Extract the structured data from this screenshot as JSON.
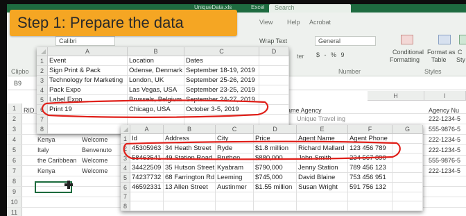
{
  "banner": {
    "text": "Step 1: Prepare the data"
  },
  "window": {
    "title_fragments": [
      "UniqueData.xls",
      "Excel"
    ],
    "search_placeholder": "Search"
  },
  "ribbon": {
    "tabs": [
      "View",
      "Help",
      "Acrobat"
    ],
    "font_name": "Calibri",
    "wrap_text": "Wrap Text",
    "number_format": "General",
    "number_symbols": "$ - % 9",
    "number_group": "Number",
    "alignment_group": "ter",
    "clipboard_group": "Clipbo",
    "conditional_formatting": [
      "Conditional",
      "Formatting"
    ],
    "format_as_table": [
      "Format as",
      "Table"
    ],
    "cell_styles": [
      "C",
      "Sty"
    ],
    "styles_group": "Styles",
    "name_box": "B9"
  },
  "background_sheet": {
    "row_numbers": [
      "1",
      "2",
      "3",
      "4",
      "5",
      "6",
      "7",
      "8",
      "9",
      "10",
      "11"
    ],
    "col_header_right": "H",
    "col_header_far_right": "I",
    "rid_label": "RID",
    "agency_headers": {
      "agency_name": "ame Agency",
      "agency_number": "Agency Nu"
    },
    "agency_rows": [
      {
        "name": "Unique Travel ing",
        "number": "222-1234-5"
      },
      {
        "name": "",
        "number": "555-9876-5"
      },
      {
        "name": "",
        "number": "222-1234-5"
      },
      {
        "name": "",
        "number": "222-1234-5"
      },
      {
        "name": "",
        "number": "555-9876-5"
      },
      {
        "name": "",
        "number": "222-1234-5"
      }
    ],
    "country_rows": [
      {
        "country": "Kenya",
        "greeting": "Welcome"
      },
      {
        "country": "Italy",
        "greeting": "Benvenuto"
      },
      {
        "country": "the Caribbean",
        "greeting": "Welcome"
      },
      {
        "country": "Kenya",
        "greeting": "Welcome"
      }
    ]
  },
  "events_sheet": {
    "columns": [
      "A",
      "B",
      "C",
      "D"
    ],
    "row_numbers": [
      "1",
      "2",
      "3",
      "4",
      "5",
      "6",
      "7",
      "8"
    ],
    "rows": [
      {
        "event": "Event",
        "location": "Location",
        "dates": "Dates"
      },
      {
        "event": "Sign Print & Pack",
        "location": "Odense, Denmark",
        "dates": "September 18-19, 2019"
      },
      {
        "event": "Technology for Marketing",
        "location": "London, UK",
        "dates": "September 25-26, 2019"
      },
      {
        "event": "Pack Expo",
        "location": "Las Vegas, USA",
        "dates": "September 23-25, 2019"
      },
      {
        "event": "Label Expo",
        "location": "Brussels, Belgium",
        "dates": "September 24-27, 2019"
      },
      {
        "event": "Print 19",
        "location": "Chicago, USA",
        "dates": "October 3-5, 2019"
      },
      {
        "event": "",
        "location": "",
        "dates": ""
      },
      {
        "event": "",
        "location": "",
        "dates": ""
      }
    ]
  },
  "listings_sheet": {
    "columns": [
      "A",
      "B",
      "C",
      "D",
      "E",
      "F",
      "G"
    ],
    "row_numbers": [
      "1",
      "2",
      "3",
      "4",
      "5",
      "6",
      "7",
      "8"
    ],
    "rows": [
      {
        "id": "Id",
        "address": "Address",
        "city": "City",
        "price": "Price",
        "agent": "Agent Name",
        "phone": "Agent Phone"
      },
      {
        "id": "45305963",
        "address": "34 Heath Street",
        "city": "Ryde",
        "price": "$1.8 million",
        "agent": "Richard Mallard",
        "phone": "123 456 789"
      },
      {
        "id": "58463541",
        "address": "49 Station Road",
        "city": "Bruthen",
        "price": "$880,000",
        "agent": "John Smith",
        "phone": "234 567 890"
      },
      {
        "id": "34422509",
        "address": "35 Hutson Street",
        "city": "Kyabram",
        "price": "$790,000",
        "agent": "Jenny Station",
        "phone": "789 456 123"
      },
      {
        "id": "74237732",
        "address": "68 Farrington Rd",
        "city": "Leeming",
        "price": "$745,000",
        "agent": "David Blaine",
        "phone": "753 456 951"
      },
      {
        "id": "46592331",
        "address": "13 Allen Street",
        "city": "Austinmer",
        "price": "$1.55 million",
        "agent": "Susan Wright",
        "phone": "591 756 132"
      },
      {
        "id": "",
        "address": "",
        "city": "",
        "price": "",
        "agent": "",
        "phone": ""
      },
      {
        "id": "",
        "address": "",
        "city": "",
        "price": "",
        "agent": "",
        "phone": ""
      }
    ]
  },
  "colors": {
    "banner": "#f5a623",
    "excel_green": "#1e6b40",
    "annotation_red": "#e0201a"
  }
}
